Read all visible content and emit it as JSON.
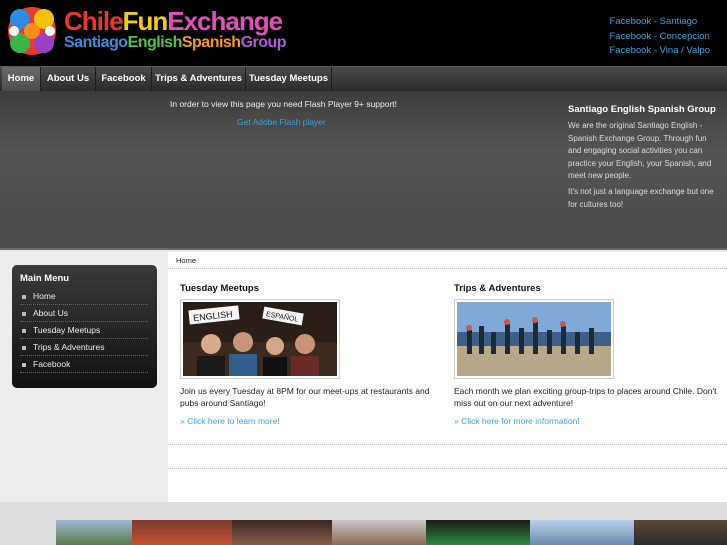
{
  "header": {
    "logo_line1_a": "Chile",
    "logo_line1_b": "Fun",
    "logo_line1_c": "Exchange",
    "logo_line2_a": "Santiago",
    "logo_line2_b": "English",
    "logo_line2_c": "Spanish",
    "logo_line2_d": "Group",
    "fb_links": [
      "Facebook - Santiago",
      "Facebook - Concepcion",
      "Facebook - Vina / Valpo"
    ]
  },
  "nav": {
    "items": [
      "Home",
      "About Us",
      "Facebook",
      "Trips & Adventures",
      "Tuesday Meetups"
    ]
  },
  "banner": {
    "flash_message": "In order to view this page you need Flash Player 9+ support!",
    "flash_link": "Get Adobe Flash player",
    "group_title": "Santiago English Spanish Group",
    "group_desc": "We are the original Santiago English - Spanish Exchange Group. Through fun and engaging social activities you can practice your English, your Spanish, and meet new people.",
    "group_desc2": "It's not just a language exchange but one for cultures too!"
  },
  "sidebar": {
    "title": "Main Menu",
    "items": [
      "Home",
      "About Us",
      "Tuesday Meetups",
      "Trips & Adventures",
      "Facebook"
    ]
  },
  "content": {
    "breadcrumb": "Home",
    "col1": {
      "title": "Tuesday Meetups",
      "sign1": "ENGLISH",
      "sign2": "ESPAÑOL",
      "text": "Join us every Tuesday at 8PM for our meet-ups at restaurants and pubs around Santiago!",
      "link": "» Click here to learn more!"
    },
    "col2": {
      "title": "Trips & Adventures",
      "text": "Each month we plan exciting group-trips to places around Chile.  Don't miss out on our next adventure!",
      "link": "» Click here for more information!"
    }
  },
  "colors": {
    "link": "#3aa5dc",
    "header_bg": "#000000",
    "nav_bg": "#333333"
  }
}
